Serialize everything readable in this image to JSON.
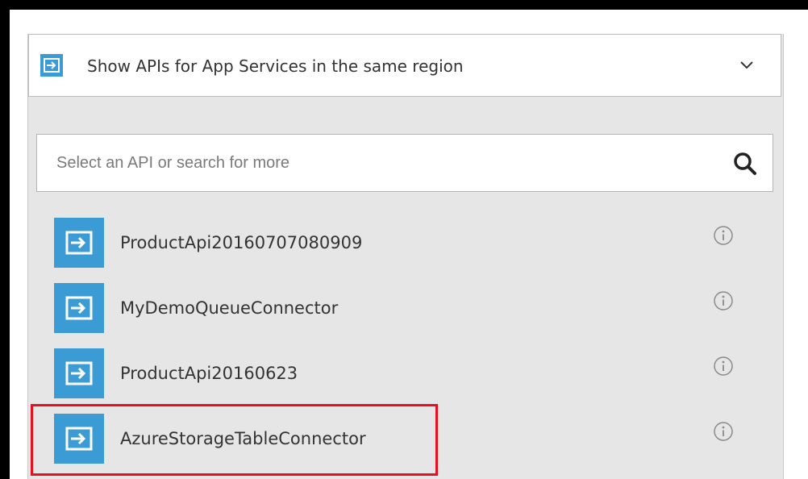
{
  "dropdown": {
    "label": "Show APIs for App Services in the same region",
    "icon": "api-app-icon",
    "chevron_icon": "chevron-down-icon"
  },
  "search": {
    "placeholder": "Select an API or search for more",
    "value": "",
    "icon": "search-icon"
  },
  "apis": [
    {
      "name": "ProductApi20160707080909",
      "icon": "api-app-icon",
      "info_icon": "info-icon"
    },
    {
      "name": "MyDemoQueueConnector",
      "icon": "api-app-icon",
      "info_icon": "info-icon"
    },
    {
      "name": "ProductApi20160623",
      "icon": "api-app-icon",
      "info_icon": "info-icon"
    },
    {
      "name": "AzureStorageTableConnector",
      "icon": "api-app-icon",
      "info_icon": "info-icon",
      "highlighted": true
    }
  ],
  "colors": {
    "accent": "#3a9bd5",
    "panel_background": "#e6e6e6",
    "highlight_border": "#e8101e",
    "outer_border": "#000000"
  }
}
